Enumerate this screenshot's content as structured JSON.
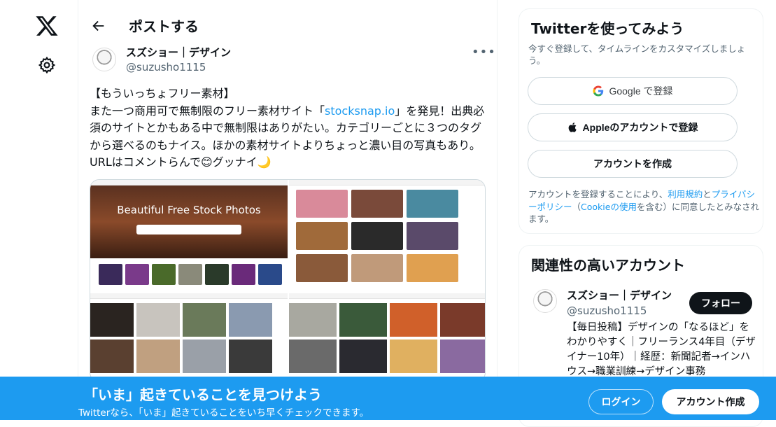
{
  "header": {
    "title": "ポストする"
  },
  "post": {
    "author_name": "スズショー｜デザイン",
    "author_handle": "@suzusho1115",
    "text_1": "【もういっちょフリー素材】\nまた一つ商用可で無制限のフリー素材サイト「",
    "link": "stocksnap.io",
    "text_2": "」を発見！出典必須のサイトとかもある中で無制限はありがたい。カテゴリーごとに３つのタグから選べるのもナイス。ほかの素材サイトよりちょっと濃い目の写真もあり。URLはコメントらんで😊グッナイ🌙",
    "media_hero_title": "Beautiful Free Stock Photos"
  },
  "signup_card": {
    "title": "Twitterを使ってみよう",
    "subtitle": "今すぐ登録して、タイムラインをカスタマイズしましょう。",
    "google_label": "Google で登録",
    "apple_label": "Appleのアカウントで登録",
    "create_label": "アカウントを作成",
    "legal_1": "アカウントを登録することにより、",
    "legal_terms": "利用規約",
    "legal_2": "と",
    "legal_privacy": "プライバシーポリシー",
    "legal_3": "（",
    "legal_cookie": "Cookieの使用",
    "legal_4": "を含む）に同意したとみなされます。"
  },
  "related": {
    "title": "関連性の高いアカウント",
    "name": "スズショー｜デザイン",
    "handle": "@suzusho1115",
    "follow_label": "フォロー",
    "bio": "【毎日投稿】デザインの「なるほど」をわかりやすく｜フリーランス4年目（デザイナー10年）｜経歴：新聞記者→インハウス→職業訓練→デザイン事務"
  },
  "bottom_bar": {
    "title": "「いま」起きていることを見つけよう",
    "subtitle": "Twitterなら、「いま」起きていることをいち早くチェックできます。",
    "login_label": "ログイン",
    "signup_label": "アカウント作成"
  },
  "icons": {
    "logo": "x-logo-icon",
    "settings": "gear-icon",
    "back": "back-arrow-icon",
    "more": "more-icon",
    "google": "google-icon",
    "apple": "apple-icon"
  },
  "colors": {
    "accent": "#1d9bf0",
    "text": "#0f1419",
    "muted": "#536471"
  }
}
